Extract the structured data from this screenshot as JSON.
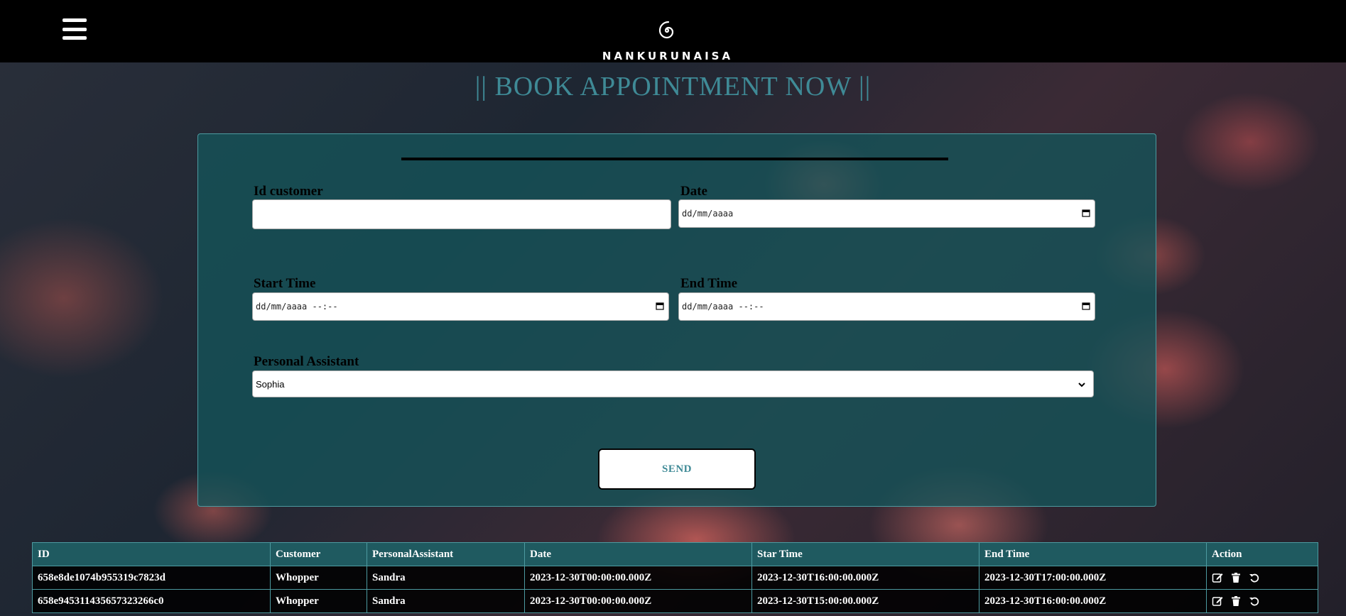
{
  "header": {
    "brand": "NANKURUNAISA",
    "menu_icon": "hamburger-menu-icon",
    "logo_icon": "spiral-logo-icon"
  },
  "page_title": "|| BOOK APPOINTMENT NOW ||",
  "form": {
    "id_customer_label": "Id customer",
    "id_customer_value": "",
    "date_label": "Date",
    "date_value": "dd/mm/aaaa",
    "start_time_label": "Start Time",
    "start_time_value": "dd/mm/aaaa --:--",
    "end_time_label": "End Time",
    "end_time_value": "dd/mm/aaaa --:--",
    "assistant_label": "Personal Assistant",
    "assistant_value": "Sophia",
    "send_label": "SEND"
  },
  "table": {
    "headers": [
      "ID",
      "Customer",
      "PersonalAssistant",
      "Date",
      "Star Time",
      "End Time",
      "Action"
    ],
    "rows": [
      {
        "id": "658e8de1074b955319c7823d",
        "customer": "Whopper",
        "assistant": "Sandra",
        "date": "2023-12-30T00:00:00.000Z",
        "start": "2023-12-30T16:00:00.000Z",
        "end": "2023-12-30T17:00:00.000Z"
      },
      {
        "id": "658e9453114356573232​66c0",
        "customer": "Whopper",
        "assistant": "Sandra",
        "date": "2023-12-30T00:00:00.000Z",
        "start": "2023-12-30T15:00:00.000Z",
        "end": "2023-12-30T16:00:00.000Z"
      }
    ],
    "action_icons": [
      "edit-icon",
      "trash-icon",
      "undo-icon"
    ]
  },
  "colors": {
    "accent_teal": "#3f8a96",
    "card_bg": "#14555a",
    "header_bg": "#000000"
  }
}
